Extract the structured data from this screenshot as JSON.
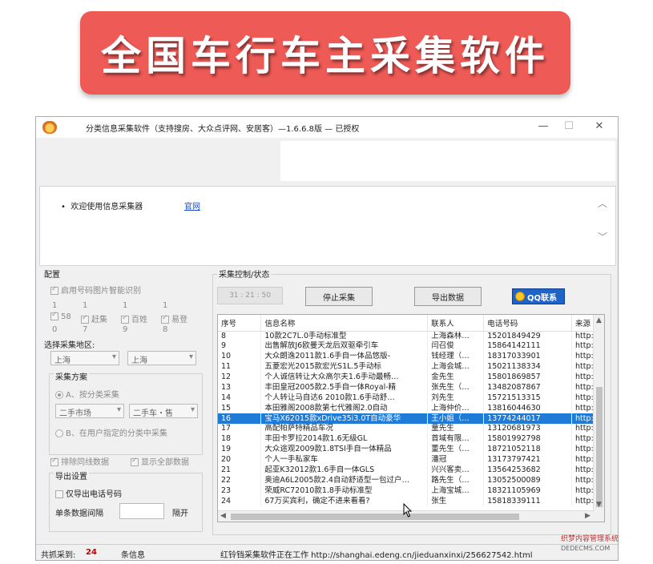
{
  "banner": {
    "title": "全国车行车主采集软件"
  },
  "window": {
    "title": "分类信息采集软件（支持搜房、大众点评网、安居客）—1.6.6.8版 — 已授权",
    "controls": {
      "minimize": "—",
      "maximize": "☐",
      "close": "✕"
    }
  },
  "info": {
    "welcome": "欢迎使用信息采集器",
    "link": "官网"
  },
  "config": {
    "title": "配置",
    "captcha": "启用号码图片智能识别",
    "sites_top": [
      "1",
      "1",
      "1",
      "1"
    ],
    "sites": [
      "58",
      "赶集",
      "百姓",
      "易登"
    ],
    "sites_bottom": [
      "0",
      "7",
      "9",
      "8"
    ],
    "region_label": "选择采集地区:",
    "province": "上海",
    "city": "上海",
    "scheme": {
      "title": "采集方案",
      "option_a": "A、按分类采集",
      "cat1": "二手市场",
      "cat2": "二手车・售",
      "option_b": "B、在用户指定的分类中采集"
    },
    "dedupe": "排除同线数据",
    "show_all": "显示全部数据",
    "export": {
      "title": "导出设置",
      "phone_only": "仅导出电话号码",
      "interval_label": "单条数据间隔",
      "separator": "隔开"
    }
  },
  "control": {
    "title": "采集控制/状态",
    "timer": "31 : 21 : 50",
    "stop_button": "停止采集",
    "export_button": "导出数据",
    "qq_button": "QQ联系"
  },
  "table": {
    "columns": [
      "序号",
      "信息名称",
      "联系人",
      "电话号码",
      "来源"
    ],
    "rows": [
      [
        "8",
        "10款2C7L.0手动标准型",
        "上海森林…",
        "15201849429",
        "http:"
      ],
      [
        "9",
        "出售解放J6欧曼天龙后双驱牵引车",
        "闫召俊",
        "15864142111",
        "http:"
      ],
      [
        "10",
        "大众朗逸2011款1.6手自一体品悠版-",
        "钱经理（…",
        "18317033901",
        "http:"
      ],
      [
        "11",
        "五菱宏光2015款宏光S1L.5手动标",
        "上海会城…",
        "15021138334",
        "http:"
      ],
      [
        "12",
        "个人诚信转让大众高尔夫1.6手动最畅…",
        "金先生",
        "15801869857",
        "http:"
      ],
      [
        "13",
        "丰田皇冠2005款2.5手自一体Royal-精",
        "张先生（…",
        "13482087867",
        "http:"
      ],
      [
        "14",
        "个人转让马自达6 2010款1.6手动舒…",
        "刘先生",
        "15721513315",
        "http:"
      ],
      [
        "15",
        "本田雅阁2008款第七代雅阁2.0自动",
        "上海仲价…",
        "13816044630",
        "http:"
      ],
      [
        "16",
        "宝马X62015款xDrive35i3.0T自动豪华",
        "王小姐（…",
        "13774244017",
        "http:"
      ],
      [
        "17",
        "高配帕萨特精品车况",
        "童先生",
        "13120681973",
        "http:"
      ],
      [
        "18",
        "丰田卡罗拉2014款1.6无级GL",
        "首域有限…",
        "15801992798",
        "http:"
      ],
      [
        "19",
        "大众途观2009款1.8TSI手自一体精品",
        "董先生（…",
        "18721052118",
        "http:"
      ],
      [
        "20",
        "个人一手私家车",
        "潘冠",
        "13173797421",
        "http:"
      ],
      [
        "21",
        "起亚K32012款1.6手自一体GLS",
        "兴兴客卖…",
        "13564253682",
        "http:"
      ],
      [
        "22",
        "奥迪A6L2005款2.4自动舒适型一包过户…",
        "路先生（…",
        "13052500089",
        "http:"
      ],
      [
        "23",
        "荣威RC72010款1.8手动标准型",
        "上海宝城…",
        "18321105969",
        "http:"
      ],
      [
        "24",
        "67万买宾利，确定不进来看看?",
        "张生",
        "15818339111",
        "http:"
      ]
    ],
    "highlight_row": 8
  },
  "status": {
    "count_label": "共抓采到:",
    "count": "24",
    "msg_label": "条信息",
    "message": "红铃铛采集软件正在工作 http://shanghai.edeng.cn/jieduanxinxi/256627542.html"
  },
  "watermark": {
    "line1": "织梦内容管理系统",
    "line2": "DEDECMS.COM"
  },
  "colors": {
    "banner": "#ee5a56",
    "highlight": "#1e7bd8",
    "qq": "#1d63c9"
  }
}
